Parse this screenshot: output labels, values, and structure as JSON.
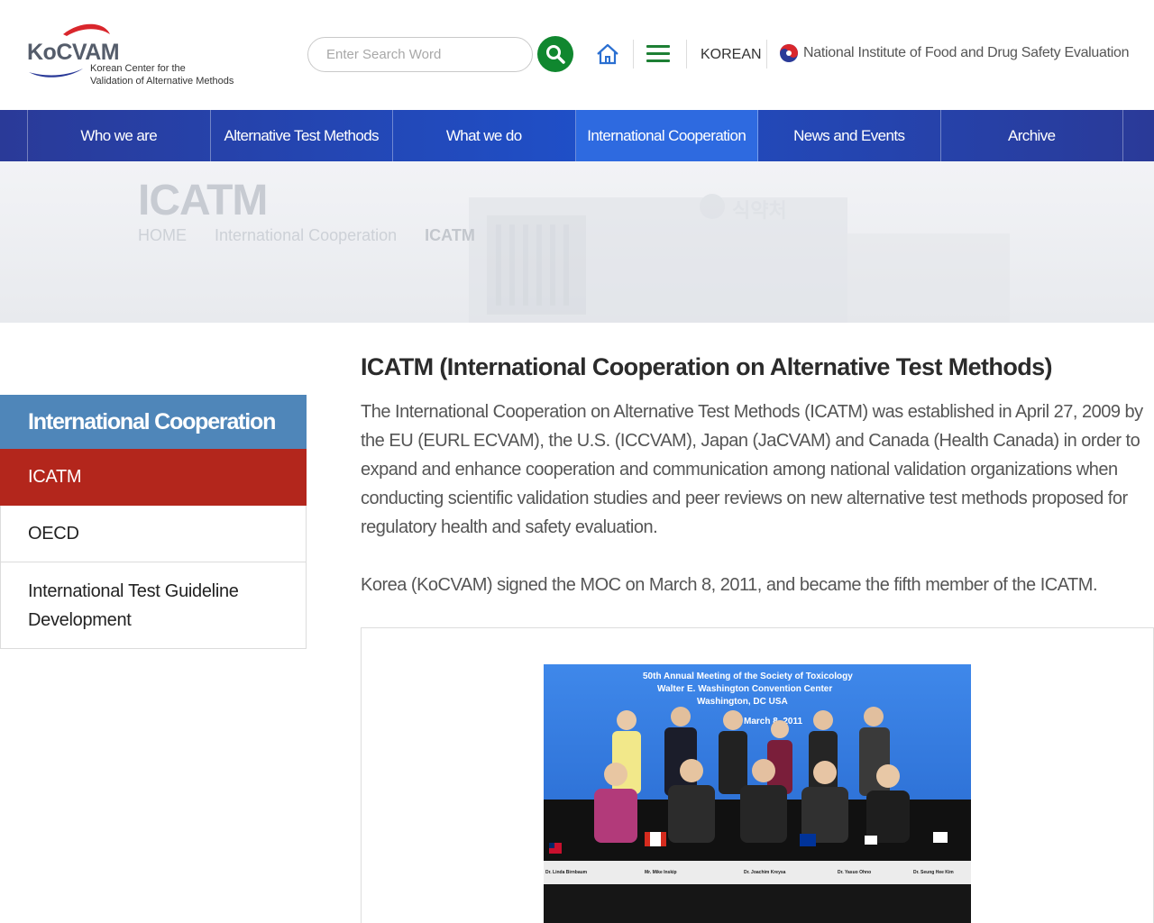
{
  "header": {
    "logo_title": "KoCVAM",
    "logo_sub1": "Korean Center for the",
    "logo_sub2": "Validation of Alternative Methods",
    "search_placeholder": "Enter Search Word",
    "korean_label": "KOREAN",
    "institute_label": "National Institute of Food and Drug Safety Evaluation"
  },
  "nav": {
    "items": [
      {
        "label": "Who we are"
      },
      {
        "label": "Alternative Test Methods"
      },
      {
        "label": "What we do"
      },
      {
        "label": "International Cooperation"
      },
      {
        "label": "News and Events"
      },
      {
        "label": "Archive"
      }
    ]
  },
  "hero": {
    "title": "ICATM",
    "crumbs": [
      "HOME",
      "International Cooperation",
      "ICATM"
    ]
  },
  "sidebar": {
    "title": "International Cooperation",
    "items": [
      {
        "label": "ICATM"
      },
      {
        "label": "OECD"
      },
      {
        "label": "International Test Guideline Development"
      }
    ]
  },
  "main": {
    "title": "ICATM (International Cooperation on Alternative Test Methods)",
    "paragraph1": "The International Cooperation on Alternative Test Methods (ICATM) was established in April 27, 2009 by the EU (EURL ECVAM), the U.S. (ICCVAM), Japan (JaCVAM) and Canada (Health Canada) in order to expand and enhance cooperation and communication among national validation organizations when conducting scientific validation studies and peer reviews on new alternative test methods proposed for regulatory health and safety evaluation.",
    "paragraph2": "Korea (KoCVAM) signed the MOC on March 8, 2011, and became the fifth member of the ICATM."
  },
  "photo": {
    "banner_line1": "50th Annual Meeting of the Society of Toxicology",
    "banner_line2": "Walter E. Washington Convention Center",
    "banner_line3": "Washington, DC USA",
    "banner_line4": "March 8, 2011",
    "nameplates": [
      "Dr. Linda Birnbaum",
      "Mr. Mike Inskip",
      "Dr. Joachim Kreysa",
      "Dr. Yasuo Ohno",
      "Dr. Seung Hee Kim"
    ]
  },
  "colors": {
    "nav_bg": "#2a3a98",
    "search_button": "#10872f",
    "sidebar_header": "#4f86b9",
    "sidebar_active": "#b3261c",
    "logo_swoosh": "#d9262c"
  }
}
